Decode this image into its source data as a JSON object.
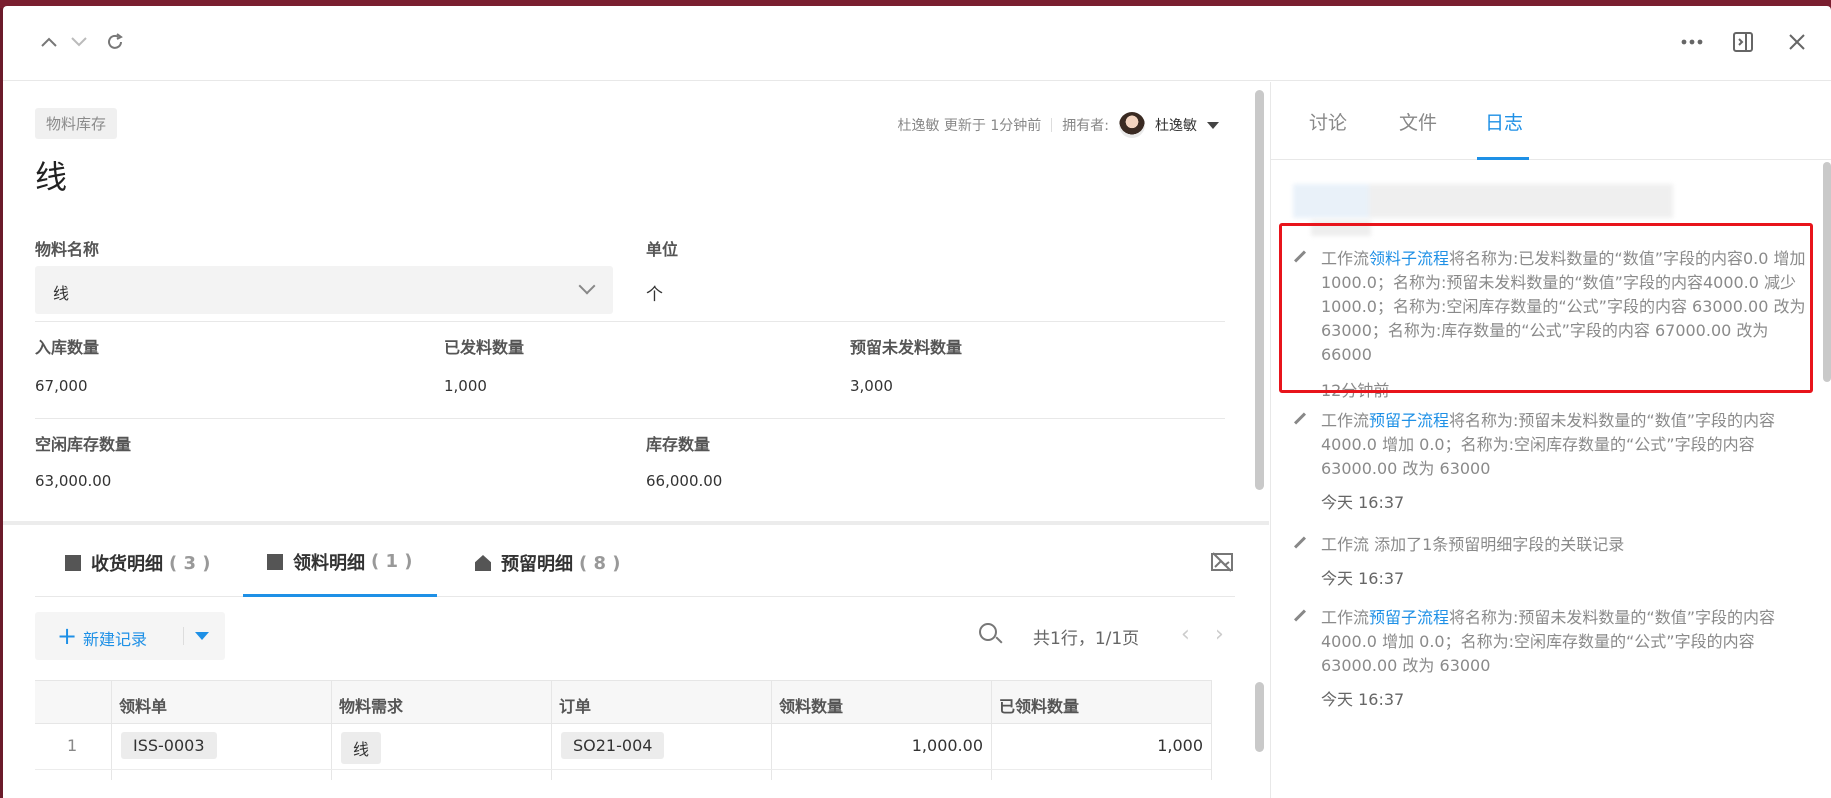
{
  "header": {
    "up_icon": "chevron-up-icon",
    "down_icon": "chevron-down-icon",
    "refresh_icon": "refresh-icon",
    "more_icon": "more-icon",
    "panel_icon": "panel-toggle-icon",
    "close_icon": "close-icon"
  },
  "record": {
    "tag": "物料库存",
    "meta_updated": "杜逸敏 更新于 1分钟前",
    "meta_owner_label": "拥有者:",
    "owner_name": "杜逸敏",
    "title": "线"
  },
  "fields": {
    "material_name_label": "物料名称",
    "material_name_value": "线",
    "unit_label": "单位",
    "unit_value": "个",
    "in_qty_label": "入库数量",
    "in_qty_value": "67,000",
    "issued_qty_label": "已发料数量",
    "issued_qty_value": "1,000",
    "reserved_label": "预留未发料数量",
    "reserved_value": "3,000",
    "free_stock_label": "空闲库存数量",
    "free_stock_value": "63,000.00",
    "stock_label": "库存数量",
    "stock_value": "66,000.00"
  },
  "tabs": [
    {
      "label": "收货明细",
      "count": "( 3 )"
    },
    {
      "label": "领料明细",
      "count": "( 1 )"
    },
    {
      "label": "预留明细",
      "count": "( 8 )"
    }
  ],
  "toolbar": {
    "new_plus": "+",
    "new_label": "新建记录",
    "pager": "共1行，1/1页",
    "prev": "‹",
    "next": "›"
  },
  "table": {
    "headers": [
      "领料单",
      "物料需求",
      "订单",
      "领料数量",
      "已领料数量"
    ],
    "rows": [
      {
        "index": "1",
        "issue": "ISS-0003",
        "demand": "线",
        "order": "SO21-004",
        "qty": "1,000.00",
        "received": "1,000"
      }
    ]
  },
  "right": {
    "tabs": [
      "讨论",
      "文件",
      "日志"
    ],
    "logs": [
      {
        "prefix": "工作流",
        "link": "领料子流程",
        "text": "将名称为:已发料数量的“数值”字段的内容0.0 增加 1000.0；名称为:预留未发料数量的“数值”字段的内容4000.0 减少 1000.0；名称为:空闲库存数量的“公式”字段的内容 63000.00 改为 63000；名称为:库存数量的“公式”字段的内容 67000.00 改为 66000",
        "time": "12分钟前"
      },
      {
        "prefix": "工作流",
        "link": "预留子流程",
        "text": "将名称为:预留未发料数量的“数值”字段的内容 4000.0 增加 0.0；名称为:空闲库存数量的“公式”字段的内容63000.00 改为 63000",
        "time": "今天 16:37"
      },
      {
        "prefix": "工作流 添加了1条预留明细字段的关联记录",
        "link": "",
        "text": "",
        "time": "今天 16:37"
      },
      {
        "prefix": "工作流",
        "link": "预留子流程",
        "text": "将名称为:预留未发料数量的“数值”字段的内容 4000.0 增加 0.0；名称为:空闲库存数量的“公式”字段的内容63000.00 改为 63000",
        "time": "今天 16:37"
      }
    ]
  },
  "colors": {
    "accent": "#1e90e6",
    "highlight": "#e8141b"
  }
}
